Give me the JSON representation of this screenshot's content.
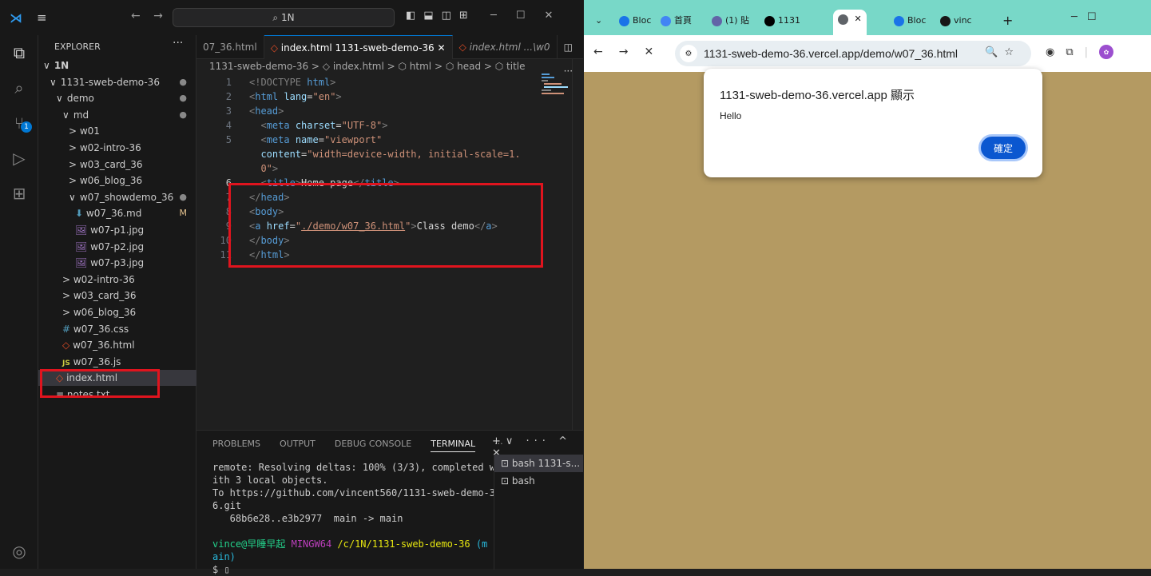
{
  "vscode": {
    "search_label": "1N",
    "explorer_title": "EXPLORER",
    "tree": [
      {
        "label": "1N",
        "chev": "∨",
        "indent": 0,
        "icon": "",
        "marker": ""
      },
      {
        "label": "1131-sweb-demo-36",
        "chev": "∨",
        "indent": 1,
        "icon": "",
        "marker": "●"
      },
      {
        "label": "demo",
        "chev": "∨",
        "indent": 2,
        "icon": "",
        "marker": "●"
      },
      {
        "label": "md",
        "chev": "∨",
        "indent": 3,
        "icon": "",
        "marker": "●"
      },
      {
        "label": "w01",
        "chev": ">",
        "indent": 4,
        "icon": "",
        "marker": ""
      },
      {
        "label": "w02-intro-36",
        "chev": ">",
        "indent": 4,
        "icon": "",
        "marker": ""
      },
      {
        "label": "w03_card_36",
        "chev": ">",
        "indent": 4,
        "icon": "",
        "marker": ""
      },
      {
        "label": "w06_blog_36",
        "chev": ">",
        "indent": 4,
        "icon": "",
        "marker": ""
      },
      {
        "label": "w07_showdemo_36",
        "chev": "∨",
        "indent": 4,
        "icon": "",
        "marker": "●"
      },
      {
        "label": "w07_36.md",
        "chev": "",
        "indent": 5,
        "icon": "md",
        "marker": "M"
      },
      {
        "label": "w07-p1.jpg",
        "chev": "",
        "indent": 5,
        "icon": "img",
        "marker": ""
      },
      {
        "label": "w07-p2.jpg",
        "chev": "",
        "indent": 5,
        "icon": "img",
        "marker": ""
      },
      {
        "label": "w07-p3.jpg",
        "chev": "",
        "indent": 5,
        "icon": "img",
        "marker": ""
      },
      {
        "label": "w02-intro-36",
        "chev": ">",
        "indent": 3,
        "icon": "",
        "marker": ""
      },
      {
        "label": "w03_card_36",
        "chev": ">",
        "indent": 3,
        "icon": "",
        "marker": ""
      },
      {
        "label": "w06_blog_36",
        "chev": ">",
        "indent": 3,
        "icon": "",
        "marker": ""
      },
      {
        "label": "w07_36.css",
        "chev": "",
        "indent": 3,
        "icon": "css",
        "marker": ""
      },
      {
        "label": "w07_36.html",
        "chev": "",
        "indent": 3,
        "icon": "html",
        "marker": ""
      },
      {
        "label": "w07_36.js",
        "chev": "",
        "indent": 3,
        "icon": "js",
        "marker": ""
      },
      {
        "label": "index.html",
        "chev": "",
        "indent": 2,
        "icon": "html",
        "marker": "",
        "selected": true
      },
      {
        "label": "notes.txt",
        "chev": "",
        "indent": 2,
        "icon": "txt",
        "marker": ""
      }
    ],
    "tabs": [
      "07_36.html",
      "index.html 1131-sweb-demo-36",
      "index.html ...\\w0"
    ],
    "breadcrumb": "1131-sweb-demo-36 > ◇ index.html > ⬡ html > ⬡ head > ⬡ title",
    "code": [
      {
        "n": "1",
        "html": "<span class='t-tag'>&lt;!DOCTYPE</span> <span class='t-name'>html</span><span class='t-tag'>&gt;</span>"
      },
      {
        "n": "2",
        "html": "<span class='t-tag'>&lt;</span><span class='t-name'>html</span> <span class='t-attr'>lang</span><span class='t-txt'>=</span><span class='t-str'>\"en\"</span><span class='t-tag'>&gt;</span>"
      },
      {
        "n": "3",
        "html": "<span class='t-tag'>&lt;</span><span class='t-name'>head</span><span class='t-tag'>&gt;</span>"
      },
      {
        "n": "4",
        "html": "&nbsp;&nbsp;<span class='t-tag'>&lt;</span><span class='t-name'>meta</span> <span class='t-attr'>charset</span><span class='t-txt'>=</span><span class='t-str'>\"UTF-8\"</span><span class='t-tag'>&gt;</span>"
      },
      {
        "n": "5",
        "html": "&nbsp;&nbsp;<span class='t-tag'>&lt;</span><span class='t-name'>meta</span> <span class='t-attr'>name</span><span class='t-txt'>=</span><span class='t-str'>\"viewport\"</span>"
      },
      {
        "n": "",
        "html": "&nbsp;&nbsp;<span class='t-attr'>content</span><span class='t-txt'>=</span><span class='t-str'>\"width=device-width, initial-scale=1.</span>"
      },
      {
        "n": "",
        "html": "&nbsp;&nbsp;<span class='t-str'>0\"</span><span class='t-tag'>&gt;</span>"
      },
      {
        "n": "6",
        "html": "&nbsp;&nbsp;<span class='t-tag'>&lt;</span><span class='t-name'>title</span><span class='t-tag'>&gt;</span><span class='t-txt'>Home page</span><span class='t-tag'>&lt;/</span><span class='t-name'>title</span><span class='t-tag'>&gt;</span>",
        "current": true
      },
      {
        "n": "7",
        "html": "<span class='t-tag'>&lt;/</span><span class='t-name'>head</span><span class='t-tag'>&gt;</span>"
      },
      {
        "n": "8",
        "html": "<span class='t-tag'>&lt;</span><span class='t-name'>body</span><span class='t-tag'>&gt;</span>"
      },
      {
        "n": "9",
        "html": "<span class='t-tag'>&lt;</span><span class='t-name'>a</span> <span class='t-attr'>href</span><span class='t-txt'>=</span><span class='t-str'>\"<u>./demo/w07_36.html</u>\"</span><span class='t-tag'>&gt;</span><span class='t-txt'>Class demo</span><span class='t-tag'>&lt;/</span><span class='t-name'>a</span><span class='t-tag'>&gt;</span>"
      },
      {
        "n": "10",
        "html": "<span class='t-tag'>&lt;/</span><span class='t-name'>body</span><span class='t-tag'>&gt;</span>"
      },
      {
        "n": "11",
        "html": "<span class='t-tag'>&lt;/</span><span class='t-name'>html</span><span class='t-tag'>&gt;</span>"
      }
    ],
    "panel_tabs": [
      "PROBLEMS",
      "OUTPUT",
      "DEBUG CONSOLE",
      "TERMINAL"
    ],
    "terminal_lines": [
      "remote: Resolving deltas: 100% (3/3), completed w",
      "ith 3 local objects.",
      "To https://github.com/vincent560/1131-sweb-demo-3",
      "6.git",
      "   68b6e28..e3b2977  main -> main",
      ""
    ],
    "prompt": {
      "user": "vince@早睡早起",
      "shell": "MINGW64",
      "path": "/c/1N/1131-sweb-demo-36",
      "branch": "(m",
      "branch2": "ain)",
      "cursor": "$ "
    },
    "shells": [
      "bash 1131-s...",
      "bash"
    ]
  },
  "browser": {
    "tabs": [
      {
        "label": "Bloc",
        "color": "#1a73e8"
      },
      {
        "label": "首頁",
        "color": "#4285f4"
      },
      {
        "label": "(1) 貼",
        "color": "#6264a7"
      },
      {
        "label": "1131",
        "color": "#000000"
      },
      {
        "label": "",
        "color": "#5f6368",
        "active": true
      },
      {
        "label": "Bloc",
        "color": "#1a73e8"
      },
      {
        "label": "vinc",
        "color": "#181717"
      }
    ],
    "url": "1131-sweb-demo-36.vercel.app/demo/w07_36.html",
    "page_bg": "#b49a62",
    "tabstrip_bg": "#78d8c8",
    "dialog": {
      "title": "1131-sweb-demo-36.vercel.app 顯示",
      "message": "Hello",
      "ok_label": "確定"
    }
  }
}
